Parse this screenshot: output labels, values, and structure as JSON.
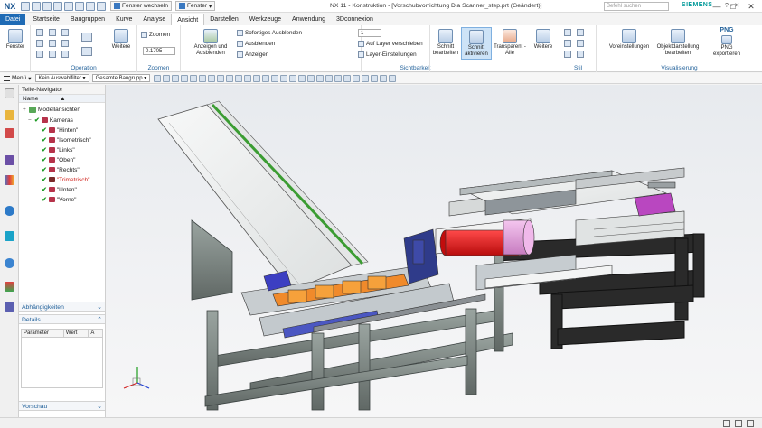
{
  "titlebar": {
    "logo": "NX",
    "window_switch_label": "Fenster wechseln",
    "window_label": "Fenster",
    "title": "NX 11 - Konstruktion - [Vorschubvorrichtung Dia Scanner_step.prt (Geändert)]",
    "brand": "SIEMENS",
    "minimize": "—",
    "maximize": "□",
    "close": "✕"
  },
  "tabs": [
    {
      "label": "Datei",
      "state": "file"
    },
    {
      "label": "Startseite"
    },
    {
      "label": "Baugruppen"
    },
    {
      "label": "Kurve"
    },
    {
      "label": "Analyse"
    },
    {
      "label": "Ansicht",
      "state": "active"
    },
    {
      "label": "Darstellen"
    },
    {
      "label": "Werkzeuge"
    },
    {
      "label": "Anwendung"
    },
    {
      "label": "3Dconnexion"
    }
  ],
  "search": {
    "placeholder": "Befehl suchen"
  },
  "ribbon": {
    "fenster": "Fenster",
    "operation_label": "Operation",
    "weitere1": "Weitere",
    "zoom_btn": "Zoomen",
    "zoom_value": "0.1705",
    "zoom_label": "Zoomen",
    "show_hide": "Anzeigen und Ausblenden",
    "sofort": "Sofortiges Ausblenden",
    "ausblenden": "Ausblenden",
    "anzeigen": "Anzeigen",
    "layer_value": "1",
    "layer_move": "Auf Layer verschieben",
    "layer_settings": "Layer-Einstellungen",
    "sichtbarkeit_label": "Sichtbarkeit",
    "schnitt_bearbeiten": "Schnitt bearbeiten",
    "schnitt_aktivieren": "Schnitt aktivieren",
    "transparent": "Transparent - Alle",
    "weitere2": "Weitere",
    "stil_label": "Stil",
    "voreinstellungen": "Voreinstellungen",
    "objektdarstellung": "Objektdarstellung bearbeiten",
    "png": "PNG",
    "png_export": "PNG exportieren",
    "visualisierung_label": "Visualisierung"
  },
  "toolbar2": {
    "menu": "Menü",
    "filter": "Kein Auswahlfilter",
    "assembly": "Gesamte Baugrupp"
  },
  "navigator": {
    "title": "Teile-Navigator",
    "column_name": "Name",
    "items": [
      {
        "label": "Modellansichten",
        "kind": "model"
      },
      {
        "label": "Kameras",
        "kind": "folder"
      },
      {
        "label": "\"Hinten\"",
        "kind": "cam"
      },
      {
        "label": "\"Isometrisch\"",
        "kind": "cam"
      },
      {
        "label": "\"Links\"",
        "kind": "cam"
      },
      {
        "label": "\"Oben\"",
        "kind": "cam"
      },
      {
        "label": "\"Rechts\"",
        "kind": "cam"
      },
      {
        "label": "\"Trimetrisch\"",
        "kind": "cam-active"
      },
      {
        "label": "\"Unten\"",
        "kind": "cam"
      },
      {
        "label": "\"Vorne\"",
        "kind": "cam"
      }
    ],
    "sections": {
      "dependencies": "Abhängigkeiten",
      "details": "Details",
      "preview": "Vorschau"
    },
    "details_columns": [
      "Parameter",
      "Wert",
      "A"
    ]
  },
  "colors": {
    "accent": "#1f6bb5",
    "active_camera": "#d0201a",
    "check": "#1c9a23"
  }
}
